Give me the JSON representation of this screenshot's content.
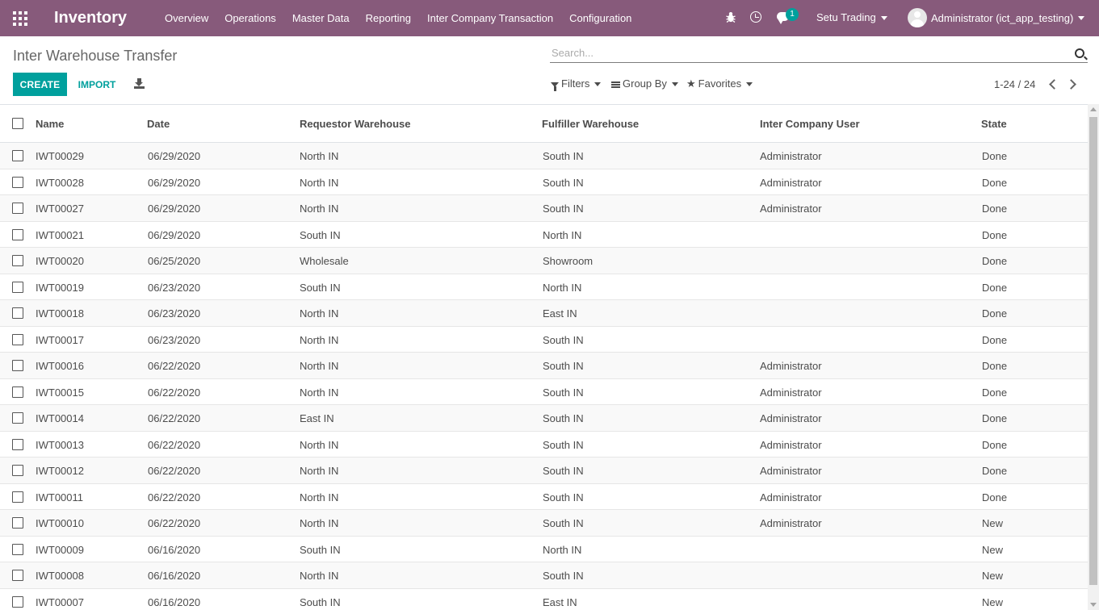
{
  "navbar": {
    "app_title": "Inventory",
    "menu": [
      "Overview",
      "Operations",
      "Master Data",
      "Reporting",
      "Inter Company Transaction",
      "Configuration"
    ],
    "message_count": "1",
    "company": "Setu Trading",
    "user": "Administrator (ict_app_testing)",
    "bg_color": "#875a7b"
  },
  "control": {
    "breadcrumb": "Inter Warehouse Transfer",
    "search_placeholder": "Search...",
    "create_label": "CREATE",
    "import_label": "IMPORT",
    "filters_label": "Filters",
    "groupby_label": "Group By",
    "favorites_label": "Favorites",
    "pager": "1-24 / 24",
    "accent_color": "#00a09d"
  },
  "list": {
    "columns": [
      "Name",
      "Date",
      "Requestor Warehouse",
      "Fulfiller Warehouse",
      "Inter Company User",
      "State"
    ],
    "rows": [
      [
        "IWT00029",
        "06/29/2020",
        "North IN",
        "South IN",
        "Administrator",
        "Done"
      ],
      [
        "IWT00028",
        "06/29/2020",
        "North IN",
        "South IN",
        "Administrator",
        "Done"
      ],
      [
        "IWT00027",
        "06/29/2020",
        "North IN",
        "South IN",
        "Administrator",
        "Done"
      ],
      [
        "IWT00021",
        "06/29/2020",
        "South IN",
        "North IN",
        "",
        "Done"
      ],
      [
        "IWT00020",
        "06/25/2020",
        "Wholesale",
        "Showroom",
        "",
        "Done"
      ],
      [
        "IWT00019",
        "06/23/2020",
        "South IN",
        "North IN",
        "",
        "Done"
      ],
      [
        "IWT00018",
        "06/23/2020",
        "North IN",
        "East IN",
        "",
        "Done"
      ],
      [
        "IWT00017",
        "06/23/2020",
        "North IN",
        "South IN",
        "",
        "Done"
      ],
      [
        "IWT00016",
        "06/22/2020",
        "North IN",
        "South IN",
        "Administrator",
        "Done"
      ],
      [
        "IWT00015",
        "06/22/2020",
        "North IN",
        "South IN",
        "Administrator",
        "Done"
      ],
      [
        "IWT00014",
        "06/22/2020",
        "East IN",
        "South IN",
        "Administrator",
        "Done"
      ],
      [
        "IWT00013",
        "06/22/2020",
        "North IN",
        "South IN",
        "Administrator",
        "Done"
      ],
      [
        "IWT00012",
        "06/22/2020",
        "North IN",
        "South IN",
        "Administrator",
        "Done"
      ],
      [
        "IWT00011",
        "06/22/2020",
        "North IN",
        "South IN",
        "Administrator",
        "Done"
      ],
      [
        "IWT00010",
        "06/22/2020",
        "North IN",
        "South IN",
        "Administrator",
        "New"
      ],
      [
        "IWT00009",
        "06/16/2020",
        "South IN",
        "North IN",
        "",
        "New"
      ],
      [
        "IWT00008",
        "06/16/2020",
        "North IN",
        "South IN",
        "",
        "New"
      ],
      [
        "IWT00007",
        "06/16/2020",
        "South IN",
        "East IN",
        "",
        "New"
      ]
    ]
  }
}
